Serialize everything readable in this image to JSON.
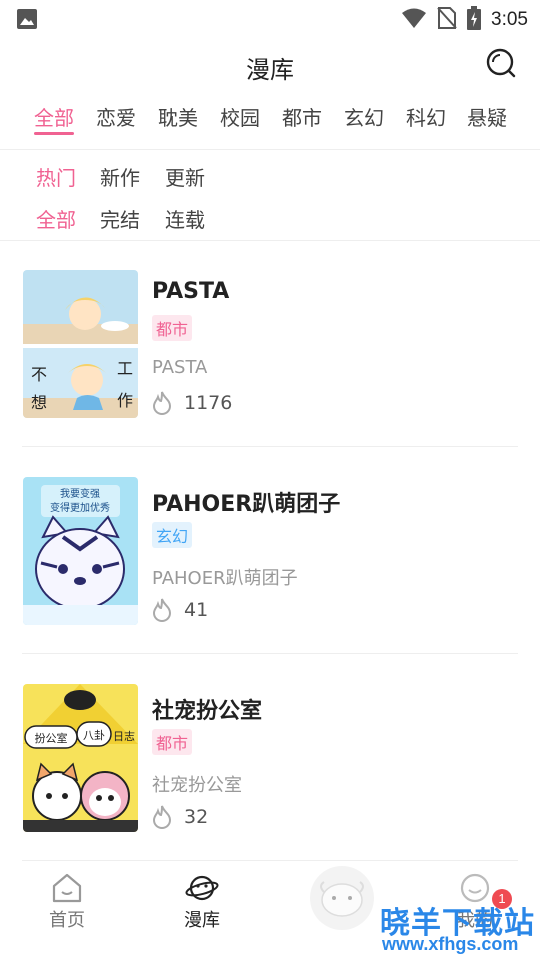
{
  "status_bar": {
    "time": "3:05"
  },
  "header": {
    "title": "漫库",
    "search_icon": "search-icon"
  },
  "category_tabs": [
    {
      "label": "全部",
      "active": true
    },
    {
      "label": "恋爱"
    },
    {
      "label": "耽美"
    },
    {
      "label": "校园"
    },
    {
      "label": "都市"
    },
    {
      "label": "玄幻"
    },
    {
      "label": "科幻"
    },
    {
      "label": "悬疑"
    }
  ],
  "sort_filters": [
    {
      "label": "热门",
      "active": true
    },
    {
      "label": "新作"
    },
    {
      "label": "更新"
    }
  ],
  "status_filters": [
    {
      "label": "全部",
      "active": true
    },
    {
      "label": "完结"
    },
    {
      "label": "连载"
    }
  ],
  "comics": [
    {
      "title": "PASTA",
      "tag": "都市",
      "subtitle": "PASTA",
      "hot": "1176",
      "cover_text": [
        "不",
        "想",
        "工",
        "作"
      ]
    },
    {
      "title": "PAHOER趴萌团子",
      "tag": "玄幻",
      "subtitle": "PAHOER趴萌团子",
      "hot": "41",
      "cover_text": [
        "我要变强",
        "变得更加优秀"
      ]
    },
    {
      "title": "社宠扮公室",
      "tag": "都市",
      "subtitle": "社宠扮公室",
      "hot": "32",
      "cover_text": [
        "扮公室",
        "八卦",
        "日志"
      ]
    }
  ],
  "bottom_nav": [
    {
      "label": "首页",
      "icon": "home-icon"
    },
    {
      "label": "漫库",
      "icon": "planet-icon",
      "active": true
    },
    {
      "label": "我的",
      "icon": "profile-icon",
      "badge": "1"
    }
  ],
  "watermark": {
    "text": "晓羊下载站",
    "url": "www.xfhgs.com"
  },
  "colors": {
    "accent": "#f06292",
    "tag_blue": "#42a5f5",
    "badge": "#ef4b52"
  }
}
